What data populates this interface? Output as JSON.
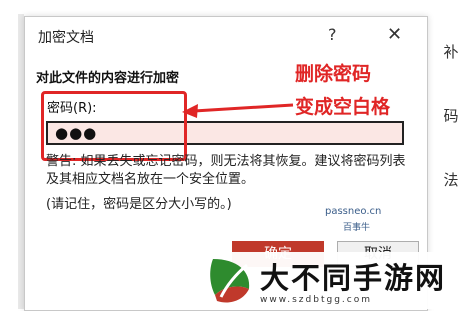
{
  "dialog": {
    "title": "加密文档",
    "help_label": "?",
    "close_label": "✕",
    "section_title": "对此文件的内容进行加密",
    "password_label": "密码(R):",
    "password_value": "●●●",
    "warning_text": "警告: 如果丢失或忘记密码，则无法将其恢复。建议将密码列表及其相应文档名放在一个安全位置。",
    "note_text": "(请记住，密码是区分大小写的。)",
    "ok_label": "确定",
    "cancel_label": "取消"
  },
  "annotation": {
    "line1": "删除密码",
    "line2": "变成空白格",
    "color": "#e02626"
  },
  "watermark": {
    "site": "passneo.cn",
    "name": "百事牛"
  },
  "banner": {
    "title": "大不同手游网",
    "url": "www.szdbtgg.com"
  },
  "side_text": [
    "补",
    "码",
    "法"
  ],
  "colors": {
    "accent": "#c0392b",
    "input_bg": "#fbe7e4"
  }
}
